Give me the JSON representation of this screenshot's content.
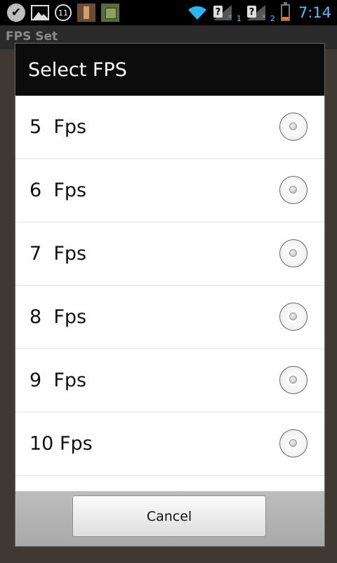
{
  "status_bar": {
    "notification_count": "11",
    "signal_1_sub": "1",
    "signal_2_sub": "2",
    "sim_x": "×",
    "time": "7:14",
    "battery_level": 0.2,
    "icons": [
      "check-icon",
      "image-icon",
      "count-icon",
      "app-icon",
      "app-icon",
      "wifi-icon",
      "signal-icon",
      "signal-icon",
      "battery-icon"
    ]
  },
  "background_app": {
    "title": "FPS Set"
  },
  "dialog": {
    "title": "Select FPS",
    "options": [
      {
        "label": "5  Fps"
      },
      {
        "label": "6  Fps"
      },
      {
        "label": "7  Fps"
      },
      {
        "label": "8  Fps"
      },
      {
        "label": "9  Fps"
      },
      {
        "label": "10 Fps"
      },
      {
        "label": ""
      }
    ],
    "cancel_label": "Cancel"
  }
}
